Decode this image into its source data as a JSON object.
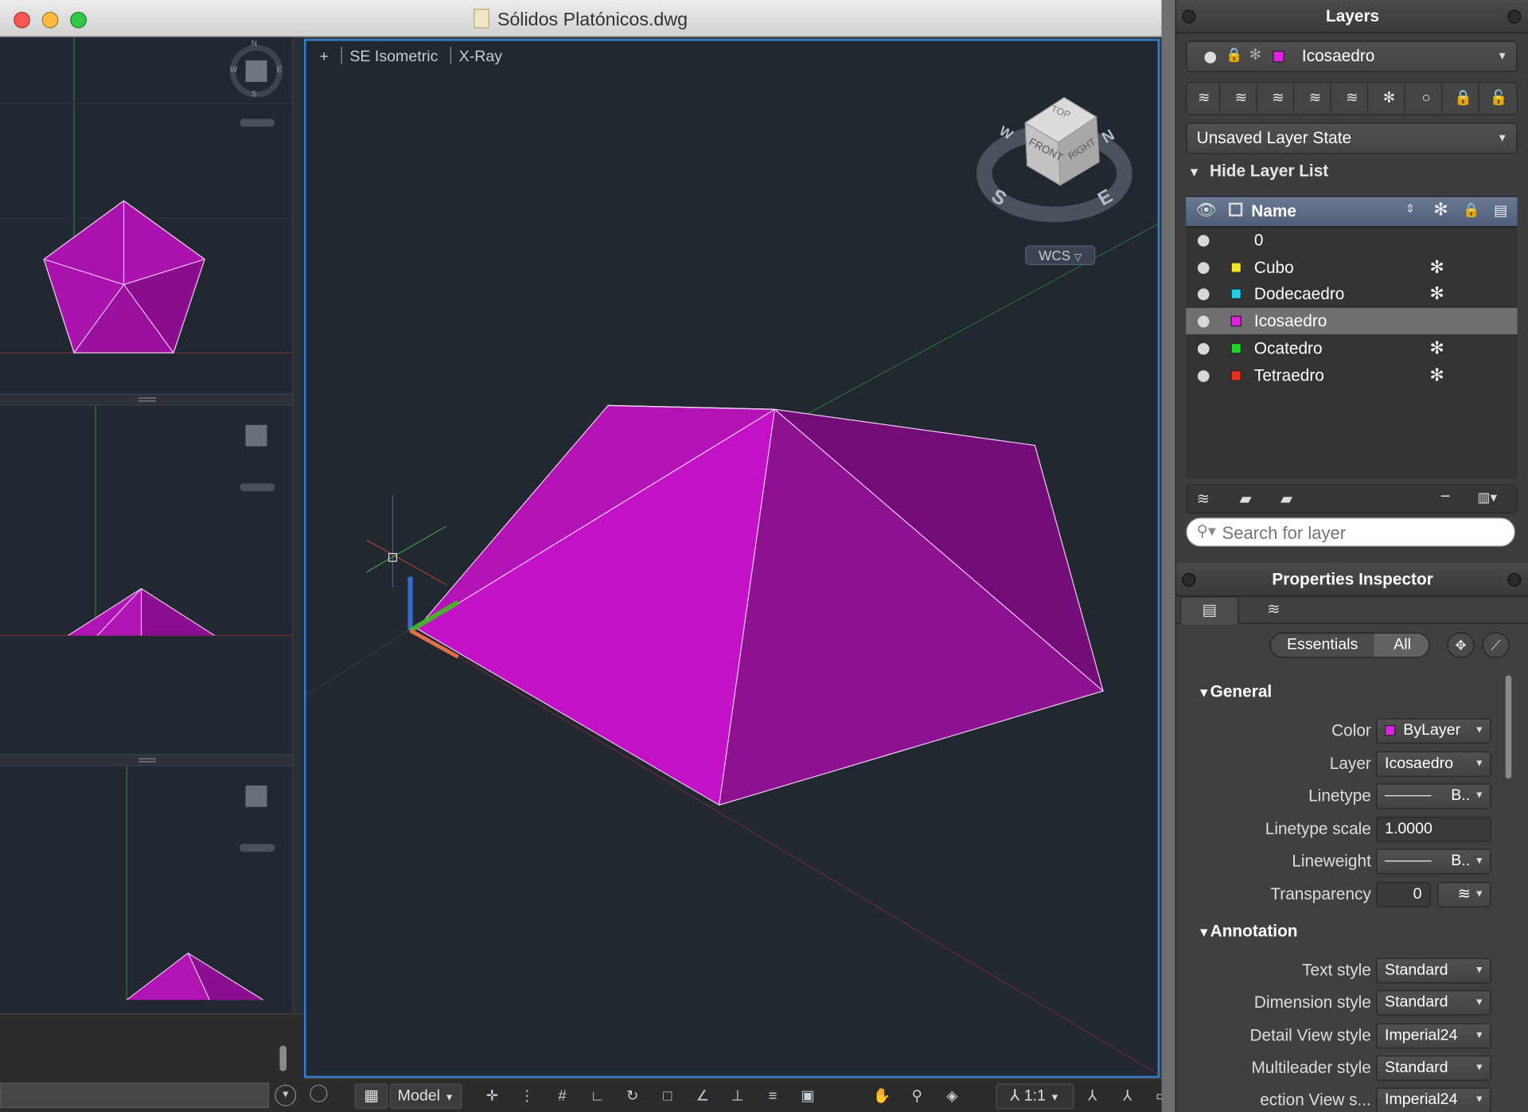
{
  "window": {
    "title": "Sólidos Platónicos.dwg"
  },
  "viewport": {
    "plus": "+",
    "view": "SE Isometric",
    "style": "X-Ray",
    "wcs": "WCS"
  },
  "viewcube": {
    "top": "TOP",
    "front": "FRONT",
    "right": "RIGHT",
    "n": "N",
    "s": "S",
    "e": "E",
    "w": "W"
  },
  "minicompass": {
    "n": "N",
    "s": "S",
    "e": "E",
    "w": "W"
  },
  "statusbar": {
    "model": "Model",
    "scale": "1:1"
  },
  "layers": {
    "title": "Layers",
    "current_layer": "Icosaedro",
    "layer_state": "Unsaved Layer State",
    "hide_list": "Hide Layer List",
    "column_name": "Name",
    "items": [
      {
        "name": "0",
        "color": "",
        "frozen": ""
      },
      {
        "name": "Cubo",
        "color": "#f5e52a",
        "frozen": "✻"
      },
      {
        "name": "Dodecaedro",
        "color": "#1fd0e6",
        "frozen": "✻"
      },
      {
        "name": "Icosaedro",
        "color": "#e020e0",
        "frozen": ""
      },
      {
        "name": "Ocatedro",
        "color": "#1ed62a",
        "frozen": "✻"
      },
      {
        "name": "Tetraedro",
        "color": "#e8321e",
        "frozen": "✻"
      }
    ],
    "search_placeholder": "Search for layer"
  },
  "properties": {
    "title": "Properties Inspector",
    "tab_essentials": "Essentials",
    "tab_all": "All",
    "general": {
      "title": "General",
      "color_label": "Color",
      "color_value": "ByLayer",
      "layer_label": "Layer",
      "layer_value": "Icosaedro",
      "linetype_label": "Linetype",
      "linetype_value": "B..",
      "ltscale_label": "Linetype scale",
      "ltscale_value": "1.0000",
      "lineweight_label": "Lineweight",
      "lineweight_value": "B..",
      "transparency_label": "Transparency",
      "transparency_value": "0"
    },
    "annotation": {
      "title": "Annotation",
      "textstyle_label": "Text style",
      "textstyle_value": "Standard",
      "dimstyle_label": "Dimension style",
      "dimstyle_value": "Standard",
      "detailstyle_label": "Detail View style",
      "detailstyle_value": "Imperial24",
      "mleaderstyle_label": "Multileader style",
      "mleaderstyle_value": "Standard",
      "sectionstyle_label": "ection View s...",
      "sectionstyle_value": "Imperial24"
    }
  },
  "colors": {
    "solid": "#c410c8",
    "accent": "#2f7fd6"
  }
}
